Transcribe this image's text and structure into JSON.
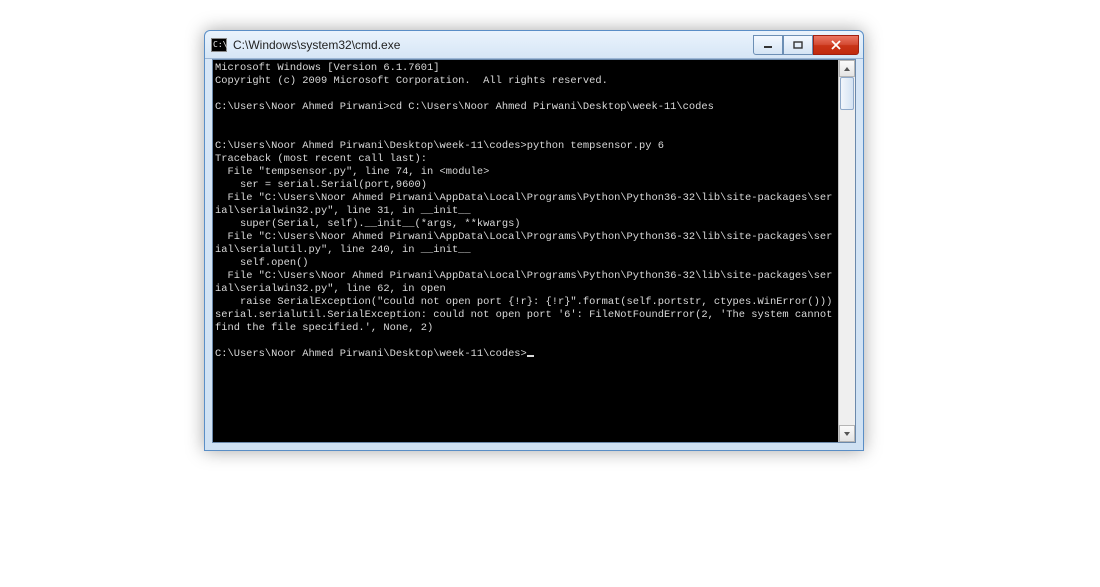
{
  "window": {
    "title": "C:\\Windows\\system32\\cmd.exe",
    "icon_label": "C:\\"
  },
  "terminal": {
    "lines": [
      "Microsoft Windows [Version 6.1.7601]",
      "Copyright (c) 2009 Microsoft Corporation.  All rights reserved.",
      "",
      "C:\\Users\\Noor Ahmed Pirwani>cd C:\\Users\\Noor Ahmed Pirwani\\Desktop\\week-11\\codes",
      "",
      "",
      "C:\\Users\\Noor Ahmed Pirwani\\Desktop\\week-11\\codes>python tempsensor.py 6",
      "Traceback (most recent call last):",
      "  File \"tempsensor.py\", line 74, in <module>",
      "    ser = serial.Serial(port,9600)",
      "  File \"C:\\Users\\Noor Ahmed Pirwani\\AppData\\Local\\Programs\\Python\\Python36-32\\lib\\site-packages\\serial\\serialwin32.py\", line 31, in __init__",
      "    super(Serial, self).__init__(*args, **kwargs)",
      "  File \"C:\\Users\\Noor Ahmed Pirwani\\AppData\\Local\\Programs\\Python\\Python36-32\\lib\\site-packages\\serial\\serialutil.py\", line 240, in __init__",
      "    self.open()",
      "  File \"C:\\Users\\Noor Ahmed Pirwani\\AppData\\Local\\Programs\\Python\\Python36-32\\lib\\site-packages\\serial\\serialwin32.py\", line 62, in open",
      "    raise SerialException(\"could not open port {!r}: {!r}\".format(self.portstr, ctypes.WinError()))",
      "serial.serialutil.SerialException: could not open port '6': FileNotFoundError(2, 'The system cannot find the file specified.', None, 2)",
      "",
      "C:\\Users\\Noor Ahmed Pirwani\\Desktop\\week-11\\codes>"
    ]
  }
}
